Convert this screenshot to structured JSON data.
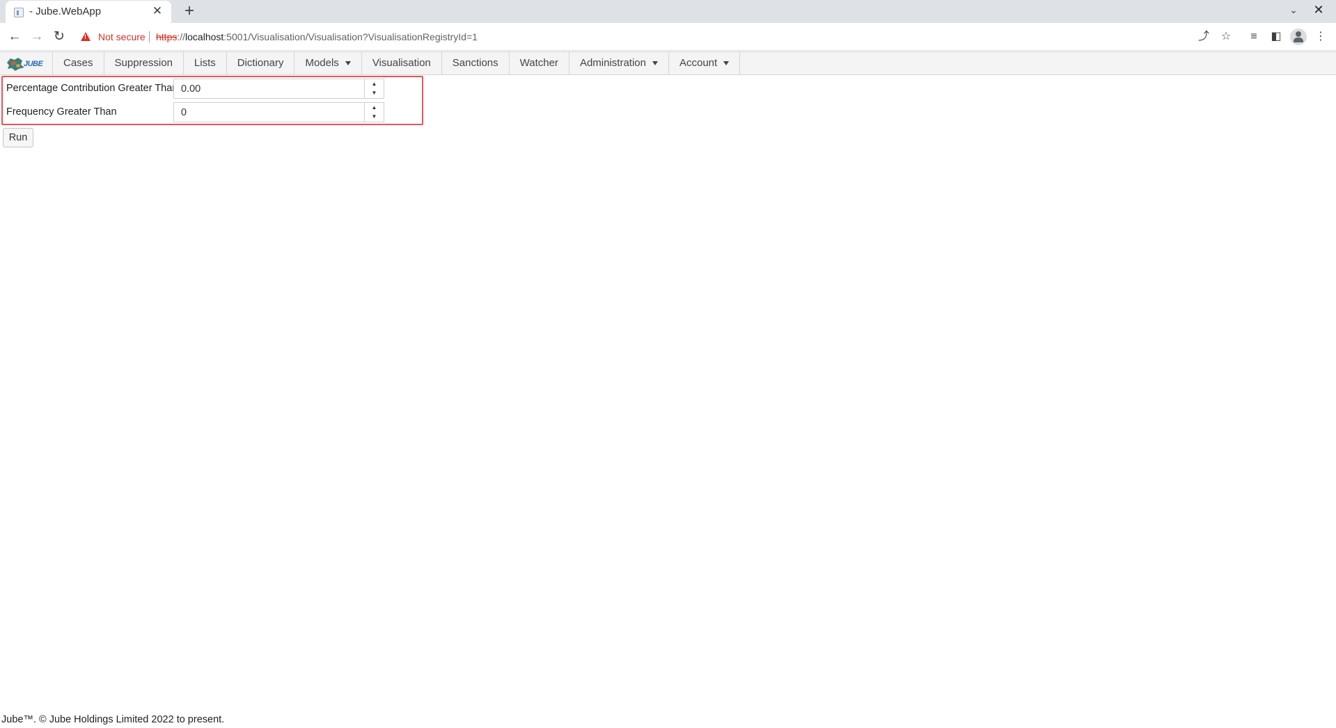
{
  "browser": {
    "tab_title": "- Jube.WebApp",
    "security_label": "Not secure",
    "url_scheme": "https",
    "url_rest_prefix": "://",
    "url_host": "localhost",
    "url_path": ":5001/Visualisation/Visualisation?VisualisationRegistryId=1"
  },
  "app": {
    "logo_text": "JUBE",
    "menu": [
      {
        "label": "Cases",
        "has_dropdown": false
      },
      {
        "label": "Suppression",
        "has_dropdown": false
      },
      {
        "label": "Lists",
        "has_dropdown": false
      },
      {
        "label": "Dictionary",
        "has_dropdown": false
      },
      {
        "label": "Models",
        "has_dropdown": true
      },
      {
        "label": "Visualisation",
        "has_dropdown": false
      },
      {
        "label": "Sanctions",
        "has_dropdown": false
      },
      {
        "label": "Watcher",
        "has_dropdown": false
      },
      {
        "label": "Administration",
        "has_dropdown": true
      },
      {
        "label": "Account",
        "has_dropdown": true
      }
    ]
  },
  "form": {
    "percentage_label": "Percentage Contribution Greater Than",
    "percentage_value": "0.00",
    "frequency_label": "Frequency Greater Than",
    "frequency_value": "0",
    "run_label": "Run"
  },
  "footer": {
    "text": "Jube™. © Jube Holdings Limited 2022 to present."
  },
  "colors": {
    "highlight_border": "#e8535a",
    "not_secure": "#d93025",
    "nav_background": "#f4f4f4"
  }
}
